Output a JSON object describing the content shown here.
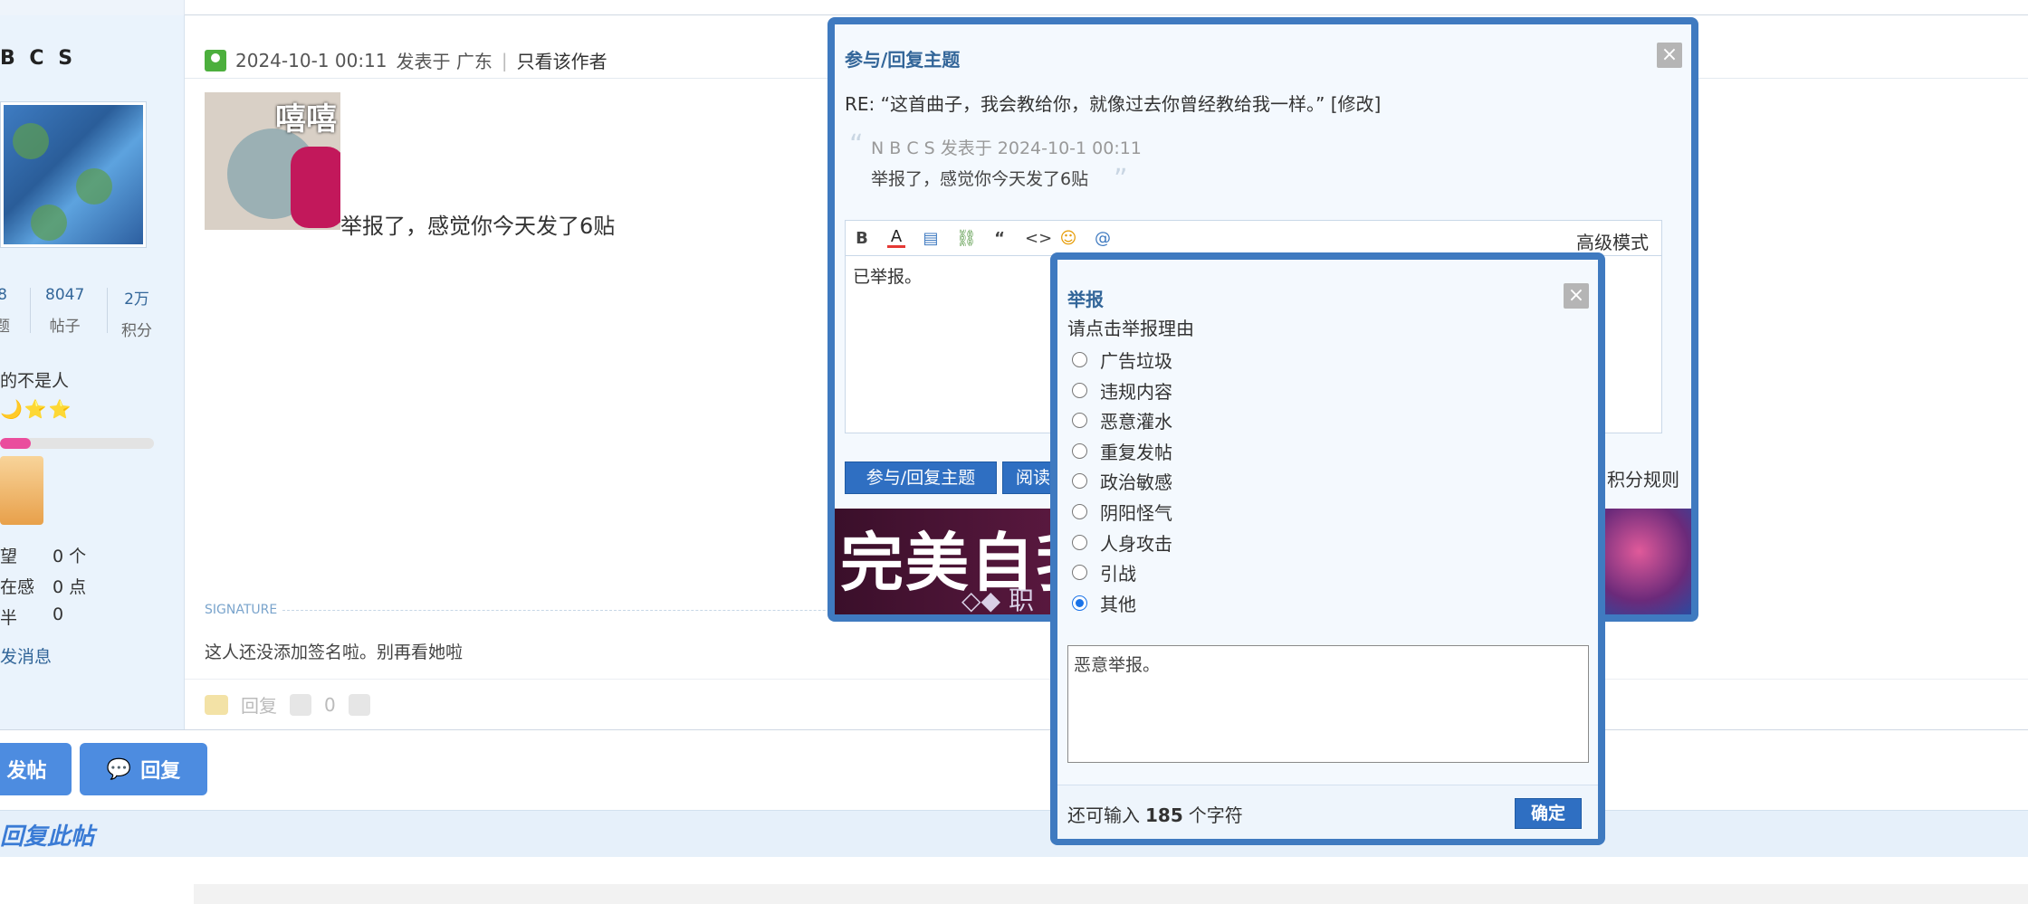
{
  "user": {
    "name_fragment": "B C S",
    "stats": [
      {
        "value": "8",
        "label": "题"
      },
      {
        "value": "8047",
        "label": "帖子"
      },
      {
        "value": "2万",
        "label": "积分"
      }
    ],
    "title": "的不是人",
    "stars": "🌙⭐⭐",
    "level_progress": 0.2,
    "fields": [
      {
        "key": "望",
        "value": "0 个"
      },
      {
        "key": "在感",
        "value": "0 点"
      },
      {
        "key": "半",
        "value": "0"
      }
    ],
    "send_message": "发消息"
  },
  "post": {
    "datetime": "2024-10-1 00:11",
    "posted_in": "发表于 广东",
    "separator": "|",
    "only_author": "只看该作者",
    "sticker_text": "嘻嘻",
    "body": "举报了，感觉你今天发了6贴",
    "signature_label": "SIGNATURE",
    "signature": "这人还没添加签名啦。别再看她啦",
    "reply_label": "回复",
    "like_count": "0"
  },
  "buttons": {
    "new_post": "发帖",
    "reply": "回复"
  },
  "reply_bar": "回复此帖",
  "reply_dialog": {
    "title": "参与/回复主题",
    "close": "×",
    "re_line": "RE: “这首曲子，我会教给你，就像过去你曾经教给我一样。”",
    "edit": "[修改]",
    "quote_open": "“",
    "quote_meta": "N B  C S 发表于 2024-10-1 00:11",
    "quote_body": "举报了，感觉你今天发了6贴",
    "quote_close": "”",
    "toolbar": [
      "B",
      "A",
      "▤",
      "⛓",
      "“",
      "<>",
      "☺",
      "@"
    ],
    "advanced_mode": "高级模式",
    "editor_text": "已举报。",
    "submit": "参与/回复主题",
    "secondary": "阅读",
    "rules": "积分规则",
    "banner_big": "完美自我",
    "banner_small": "◇◆  职"
  },
  "report_dialog": {
    "title": "举报",
    "close": "×",
    "prompt": "请点击举报理由",
    "options": [
      "广告垃圾",
      "违规内容",
      "恶意灌水",
      "重复发帖",
      "政治敏感",
      "阴阳怪气",
      "人身攻击",
      "引战",
      "其他"
    ],
    "selected": "其他",
    "reason_text": "恶意举报。",
    "remain_prefix": "还可输入",
    "remain_count": "185",
    "remain_suffix": "个字符",
    "confirm": "确定"
  }
}
